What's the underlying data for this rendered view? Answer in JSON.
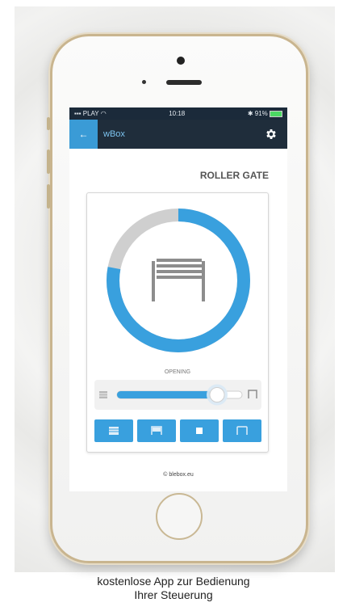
{
  "status_bar": {
    "carrier": "PLAY",
    "time": "10:18",
    "battery": "91%"
  },
  "app_bar": {
    "title": "wBox",
    "back_icon": "back-arrow-icon",
    "settings_icon": "gear-icon"
  },
  "device": {
    "title": "ROLLER GATE",
    "state": "OPENING",
    "position_percent": 78,
    "slider_value": 0.8
  },
  "mode_buttons": [
    {
      "icon": "gate-closed-icon"
    },
    {
      "icon": "gate-half-icon"
    },
    {
      "icon": "stop-icon"
    },
    {
      "icon": "gate-open-icon"
    }
  ],
  "footer": "© blebox.eu",
  "caption": {
    "line1": "kostenlose App zur Bedienung",
    "line2": "Ihrer Steuerung"
  },
  "colors": {
    "accent": "#39a0de",
    "ring_track": "#cfcfcf",
    "app_bar": "#1f2d3b"
  }
}
